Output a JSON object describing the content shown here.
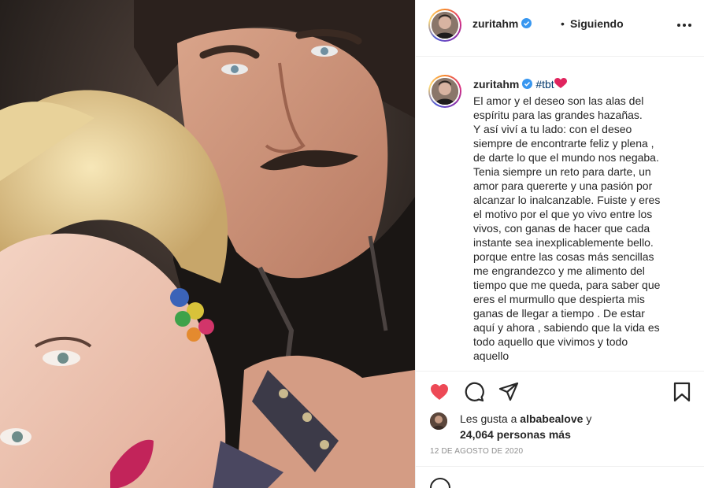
{
  "post": {
    "username": "zuritahm",
    "separator": "•",
    "follow_status": "Siguiendo",
    "hashtag": "#tbt",
    "caption_lines": [
      "El amor y el deseo son las alas del",
      "espíritu para las grandes hazañas.",
      "Y así viví a tu lado: con el deseo",
      "siempre de encontrarte feliz y plena ,",
      "de darte lo que el mundo nos negaba.",
      "Tenia siempre un reto para darte, un",
      "amor para quererte y una pasión por",
      "alcanzar lo inalcanzable. Fuiste y eres",
      "el motivo por el que yo vivo entre los",
      "vivos, con ganas de hacer que cada",
      "instante sea inexplicablemente bello.",
      "porque entre las cosas más sencillas",
      "me engrandezco y me alimento del",
      "tiempo que me queda, para saber que",
      "eres el murmullo que despierta mis",
      "ganas de llegar a tiempo . De estar",
      "aquí y ahora , sabiendo que la vida es",
      "todo aquello que vivimos y todo",
      "aquello"
    ],
    "likes_prefix": "Les gusta a",
    "liked_by": "albabealove",
    "likes_conjunction": "y",
    "likes_count_text": "24,064 personas más",
    "date": "12 DE AGOSTO DE 2020"
  },
  "icons": {
    "like": "heart-icon",
    "comment": "comment-icon",
    "share": "share-icon",
    "save": "bookmark-icon",
    "more": "more-options-icon",
    "verified": "verified-badge-icon",
    "emoji": "emoji-icon"
  },
  "colors": {
    "like_red": "#ed4956",
    "verified_blue": "#3897f0",
    "hashtag_blue": "#00376b",
    "text": "#262626",
    "muted": "#8e8e8e"
  }
}
